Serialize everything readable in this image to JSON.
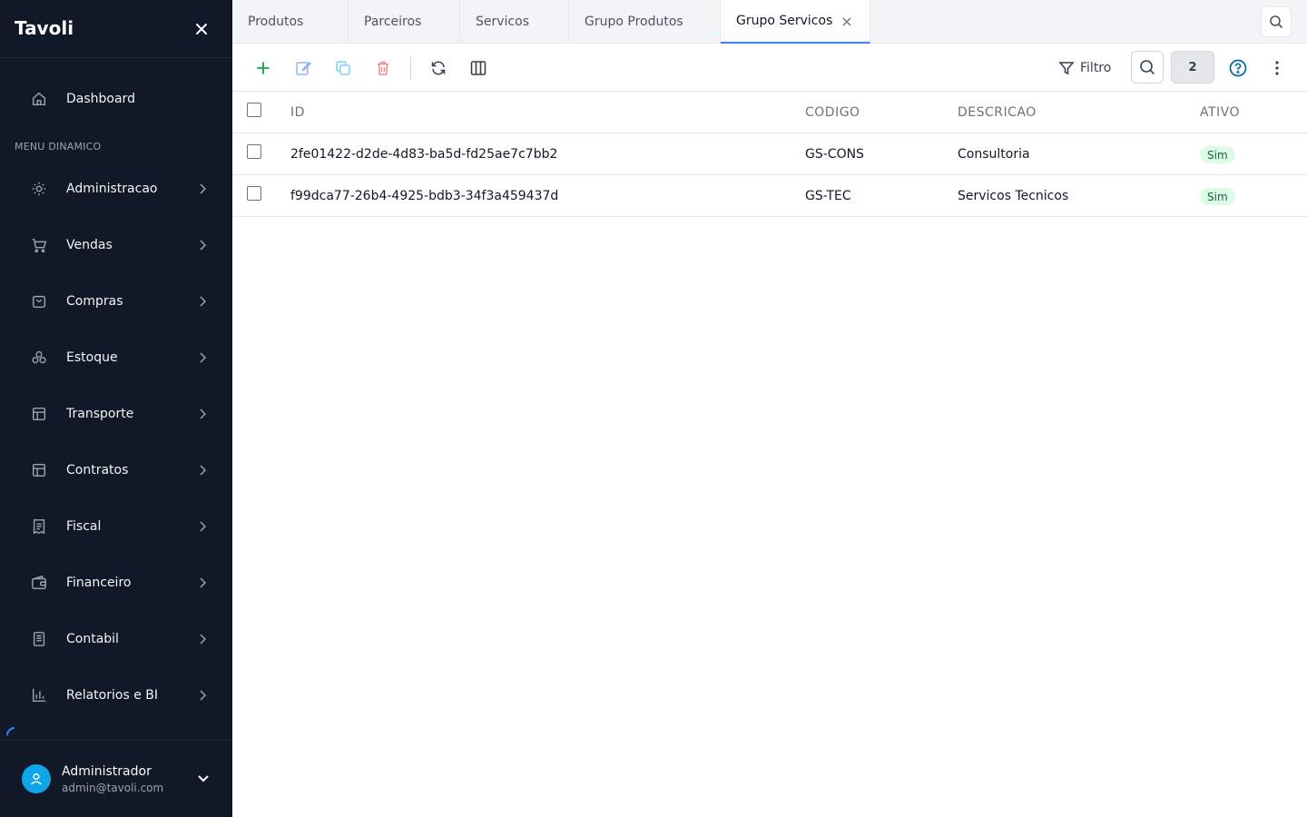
{
  "sidebar": {
    "brand": "Tavoli",
    "dashboard": "Dashboard",
    "section_label": "MENU DINAMICO",
    "items": [
      {
        "label": "Administracao",
        "icon": "gear-icon"
      },
      {
        "label": "Vendas",
        "icon": "cart-icon"
      },
      {
        "label": "Compras",
        "icon": "bag-icon"
      },
      {
        "label": "Estoque",
        "icon": "boxes-icon"
      },
      {
        "label": "Transporte",
        "icon": "layout-icon"
      },
      {
        "label": "Contratos",
        "icon": "layout-icon"
      },
      {
        "label": "Fiscal",
        "icon": "receipt-icon"
      },
      {
        "label": "Financeiro",
        "icon": "wallet-icon"
      },
      {
        "label": "Contabil",
        "icon": "book-icon"
      },
      {
        "label": "Relatorios e BI",
        "icon": "chart-icon"
      }
    ],
    "user": {
      "name": "Administrador",
      "email": "admin@tavoli.com"
    }
  },
  "tabs": [
    {
      "label": "Produtos"
    },
    {
      "label": "Parceiros"
    },
    {
      "label": "Servicos"
    },
    {
      "label": "Grupo Produtos"
    },
    {
      "label": "Grupo Servicos",
      "active": true
    }
  ],
  "toolbar": {
    "filter_label": "Filtro",
    "count": "2"
  },
  "table": {
    "columns": [
      "ID",
      "CODIGO",
      "DESCRICAO",
      "ATIVO"
    ],
    "rows": [
      {
        "id": "2fe01422-d2de-4d83-ba5d-fd25ae7c7bb2",
        "codigo": "GS-CONS",
        "descricao": "Consultoria",
        "ativo": "Sim"
      },
      {
        "id": "f99dca77-26b4-4925-bdb3-34f3a459437d",
        "codigo": "GS-TEC",
        "descricao": "Servicos Tecnicos",
        "ativo": "Sim"
      }
    ]
  },
  "colors": {
    "sidebar_bg": "#111827",
    "accent": "#3b82f6",
    "add_green": "#16a34a",
    "delete_red": "#ef4444",
    "avatar": "#0ea5e9",
    "badge_bg": "#dcfce7",
    "badge_text": "#166534"
  }
}
